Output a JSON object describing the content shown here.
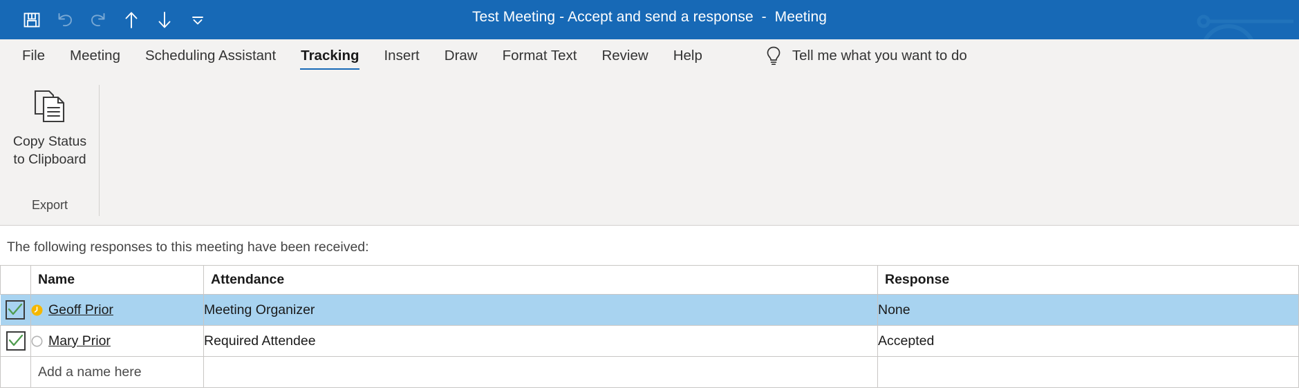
{
  "titlebar": {
    "title": "Test Meeting - Accept and send a response  -  Meeting",
    "accent_color": "#1769b6",
    "quick_access": [
      {
        "name": "save-icon",
        "label": "Save",
        "enabled": true
      },
      {
        "name": "undo-icon",
        "label": "Undo",
        "enabled": false
      },
      {
        "name": "redo-icon",
        "label": "Redo",
        "enabled": false
      },
      {
        "name": "previous-item-icon",
        "label": "Previous Item",
        "enabled": true
      },
      {
        "name": "next-item-icon",
        "label": "Next Item",
        "enabled": true
      },
      {
        "name": "customize-quick-access-toolbar-icon",
        "label": "Customize Quick Access Toolbar",
        "enabled": true
      }
    ]
  },
  "ribbon": {
    "tabs": [
      {
        "label": "File",
        "active": false
      },
      {
        "label": "Meeting",
        "active": false
      },
      {
        "label": "Scheduling Assistant",
        "active": false
      },
      {
        "label": "Tracking",
        "active": true
      },
      {
        "label": "Insert",
        "active": false
      },
      {
        "label": "Draw",
        "active": false
      },
      {
        "label": "Format Text",
        "active": false
      },
      {
        "label": "Review",
        "active": false
      },
      {
        "label": "Help",
        "active": false
      }
    ],
    "tell_me": {
      "icon": "lightbulb-icon",
      "label": "Tell me what you want to do"
    },
    "active_tab_underline_color": "#1769b6",
    "groups": [
      {
        "label": "Export",
        "buttons": [
          {
            "name": "copy-status-to-clipboard-button",
            "icon": "copy-pages-icon",
            "label": "Copy Status\nto Clipboard"
          }
        ]
      }
    ]
  },
  "main": {
    "intro": "The following responses to this meeting have been received:",
    "table": {
      "columns": [
        "",
        "Name",
        "Attendance",
        "Response"
      ],
      "rows": [
        {
          "checked": true,
          "presence": "away-clock-icon",
          "presence_color": "#f5b700",
          "name": "Geoff Prior",
          "attendance": "Meeting Organizer",
          "response": "None",
          "selected": true
        },
        {
          "checked": true,
          "presence": "offline-circle-icon",
          "presence_color": "#b3b3b3",
          "name": "Mary Prior",
          "attendance": "Required Attendee",
          "response": "Accepted",
          "selected": false
        }
      ],
      "new_row_placeholder": "Add a name here"
    },
    "selection_color": "#a8d3f0",
    "check_color": "#4f9c4f"
  }
}
